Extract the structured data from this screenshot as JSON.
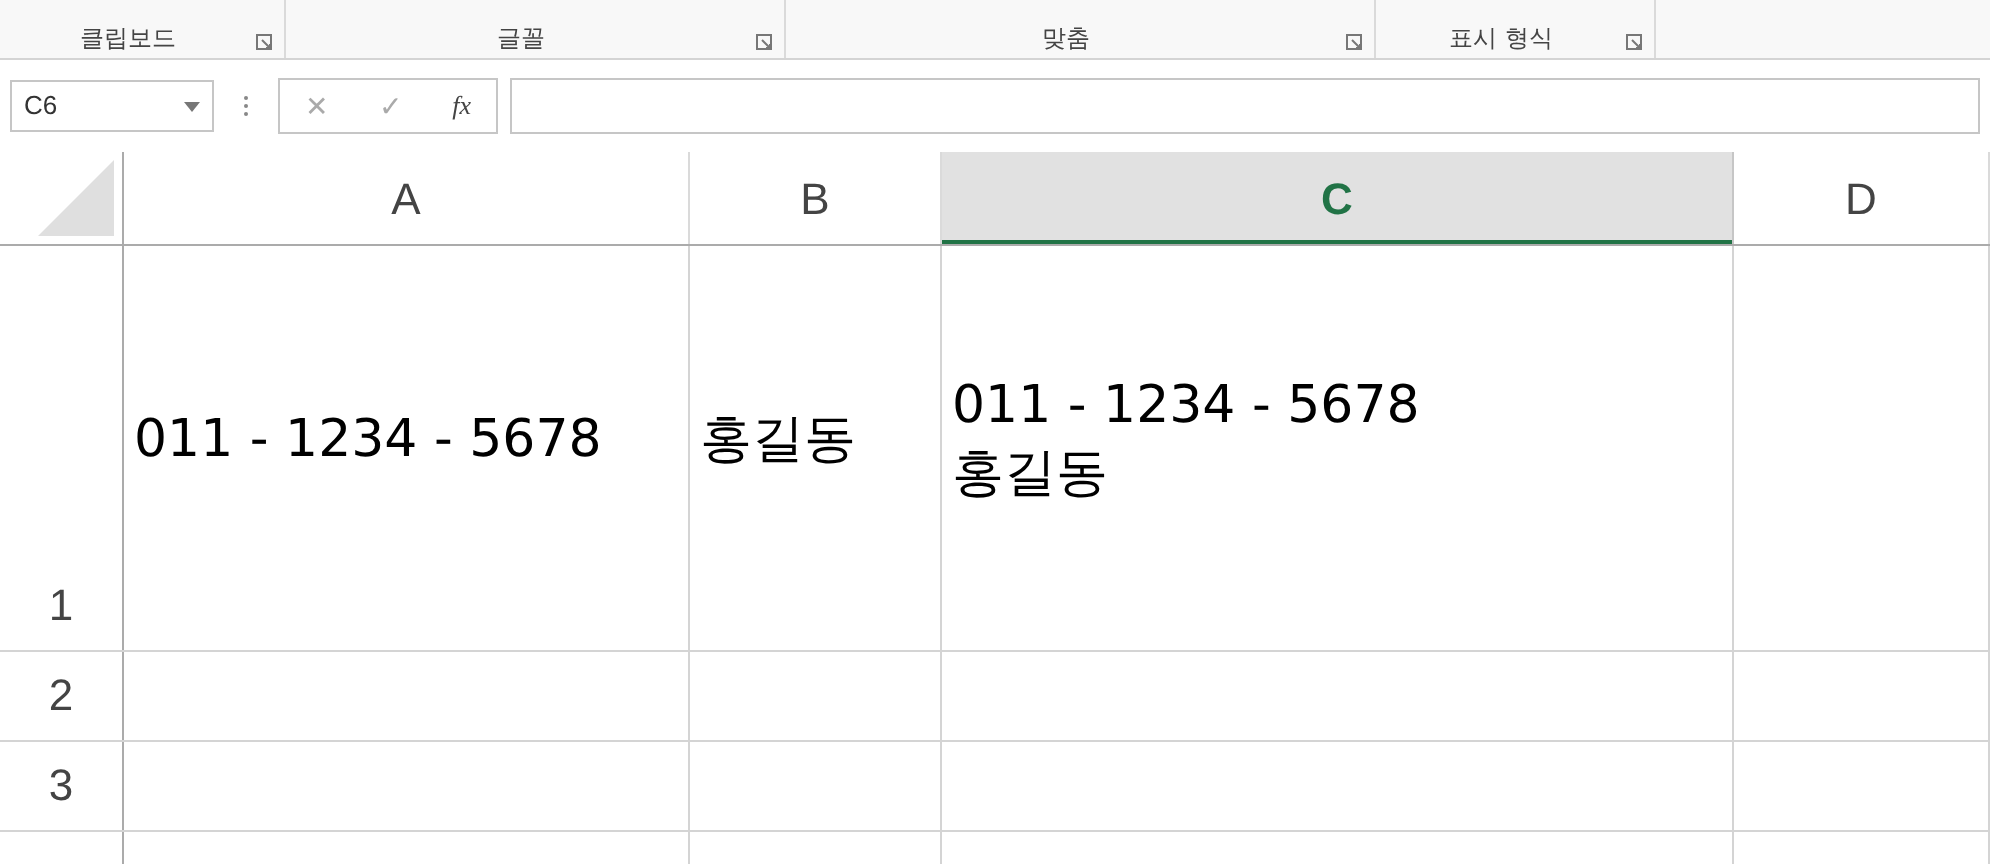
{
  "ribbon": {
    "groups": [
      {
        "label": "클립보드"
      },
      {
        "label": "글꼴"
      },
      {
        "label": "맞춤"
      },
      {
        "label": "표시 형식"
      }
    ]
  },
  "formula_bar": {
    "name_box": "C6",
    "cancel": "✕",
    "enter": "✓",
    "function": "fx"
  },
  "sheet": {
    "columns": [
      {
        "label": "A",
        "selected": false
      },
      {
        "label": "B",
        "selected": false
      },
      {
        "label": "C",
        "selected": true
      },
      {
        "label": "D",
        "selected": false
      }
    ],
    "rows": [
      {
        "label": "1",
        "cells": [
          {
            "lines": [
              "011 - 1234 - 5678"
            ]
          },
          {
            "lines": [
              "홍길동"
            ]
          },
          {
            "lines": [
              "011 - 1234 - 5678",
              "홍길동"
            ]
          }
        ]
      },
      {
        "label": "2"
      },
      {
        "label": "3"
      }
    ]
  }
}
